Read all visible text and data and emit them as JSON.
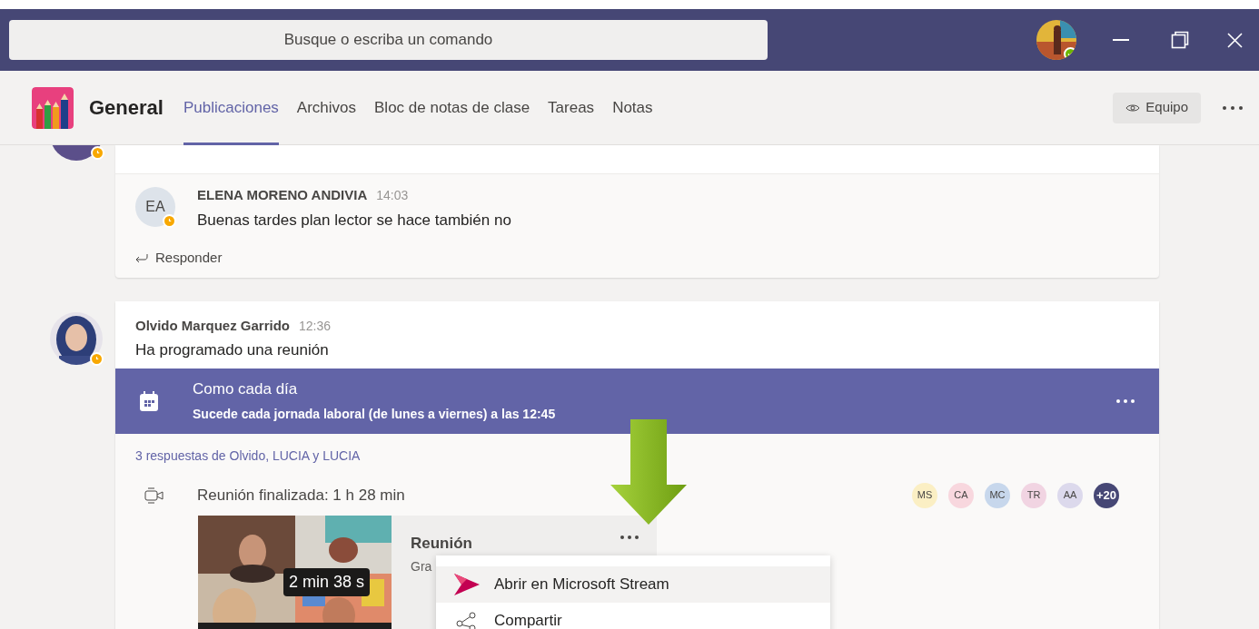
{
  "title_bar": {
    "search": {
      "placeholder": "Busque o escriba un comando"
    },
    "user_away": false
  },
  "channel": {
    "name": "General",
    "tabs": [
      {
        "label": "Publicaciones",
        "selected": true
      },
      {
        "label": "Archivos",
        "selected": false
      },
      {
        "label": "Bloc de notas de clase",
        "selected": false
      },
      {
        "label": "Tareas",
        "selected": false
      },
      {
        "label": "Notas",
        "selected": false
      }
    ],
    "team_button": "Equipo"
  },
  "previous_thread": {
    "author_away": true,
    "reply": {
      "initials": "EA",
      "away": true,
      "author": "ELENA MORENO ANDIVIA",
      "time": "14:03",
      "text": "Buenas tardes plan lector se hace también no"
    },
    "reply_action": "Responder"
  },
  "meeting_post": {
    "author": "Olvido Marquez Garrido",
    "away": true,
    "time": "12:36",
    "text": "Ha programado una reunión",
    "event": {
      "title": "Como cada día",
      "schedule": "Sucede cada jornada laboral (de lunes a viernes) a las 12:45"
    },
    "replies_summary": "3 respuestas de Olvido, LUCIA y LUCIA",
    "meeting": {
      "status": "Reunión finalizada: 1 h 28 min",
      "participants": [
        {
          "initials": "MS",
          "color": "#fbefc4"
        },
        {
          "initials": "CA",
          "color": "#f8d7de"
        },
        {
          "initials": "MC",
          "color": "#c7d7ec"
        },
        {
          "initials": "TR",
          "color": "#f1d4e2"
        },
        {
          "initials": "AA",
          "color": "#dcd9ec"
        },
        {
          "initials": "+20",
          "color": "#464775"
        }
      ],
      "recording": {
        "title": "Reunión",
        "subtitle": "Gra",
        "duration": "2 min 38 s"
      }
    }
  },
  "context_menu": [
    {
      "label": "Abrir en Microsoft Stream",
      "selected": true
    },
    {
      "label": "Compartir",
      "selected": false
    }
  ]
}
